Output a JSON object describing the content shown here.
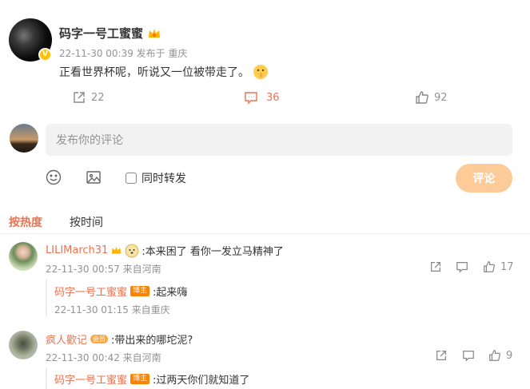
{
  "post": {
    "author": "码字一号工蜜蜜",
    "meta": "22-11-30 00:39 发布于 重庆",
    "content": "正看世界杯呢，听说又一位被带走了。",
    "reposts": "22",
    "comments": "36",
    "likes": "92"
  },
  "composer": {
    "placeholder": "发布你的评论",
    "repost_label": "同时转发",
    "submit_label": "评论"
  },
  "sort_tabs": {
    "hot": "按热度",
    "time": "按时间"
  },
  "comments": [
    {
      "user": "LILIMarch31",
      "text": ":本来困了 看你一发立马精神了",
      "meta": "22-11-30 00:57 来自河南",
      "likes": "17",
      "reply": {
        "user": "码字一号工蜜蜜",
        "badge": "博主",
        "text": ":起来嗨",
        "meta": "22-11-30 01:15 来自重庆"
      }
    },
    {
      "user": "疯人歡记",
      "vip_badge": "会员",
      "text": ":带出来的哪坨泥?",
      "meta": "22-11-30 00:42 来自河南",
      "likes": "9",
      "reply": {
        "user": "码字一号工蜜蜜",
        "badge": "博主",
        "text": ":过两天你们就知道了"
      }
    }
  ],
  "colors": {
    "accent": "#eb7350",
    "submit_bg": "#fdcb98",
    "input_bg": "#f2f2f2"
  }
}
